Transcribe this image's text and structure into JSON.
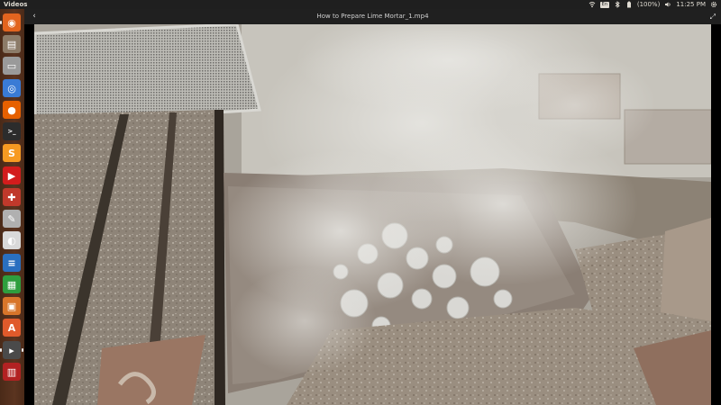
{
  "top_panel": {
    "app_name": "Videos",
    "battery": "(100%)",
    "time": "11:25 PM",
    "keyboard": "En",
    "icons": [
      "wifi-icon",
      "keyboard-layout-icon",
      "bluetooth-icon",
      "battery-icon",
      "volume-icon",
      "settings-gear-icon"
    ]
  },
  "launcher": {
    "items": [
      {
        "name": "ubuntu-dash-icon",
        "glyph": "◉",
        "color": "#e2641f"
      },
      {
        "name": "files-icon",
        "glyph": "▤",
        "color": "#8c7b68"
      },
      {
        "name": "disk-drive-icon",
        "glyph": "▭",
        "color": "#9a9a9a"
      },
      {
        "name": "chromium-icon",
        "glyph": "◎",
        "color": "#3a7bd5"
      },
      {
        "name": "firefox-icon",
        "glyph": "●",
        "color": "#e66000"
      },
      {
        "name": "terminal-icon",
        "glyph": ">_",
        "color": "#2c2c2c"
      },
      {
        "name": "sublime-text-icon",
        "glyph": "S",
        "color": "#f79a22"
      },
      {
        "name": "youtube-icon",
        "glyph": "▶",
        "color": "#d31c1c"
      },
      {
        "name": "system-tools-icon",
        "glyph": "✚",
        "color": "#c0392b"
      },
      {
        "name": "text-editor-icon",
        "glyph": "✎",
        "color": "#b0b0b0"
      },
      {
        "name": "update-manager-icon",
        "glyph": "◐",
        "color": "#d9d9d9"
      },
      {
        "name": "writer-document-icon",
        "glyph": "≡",
        "color": "#2a6fbf"
      },
      {
        "name": "calc-spreadsheet-icon",
        "glyph": "▦",
        "color": "#2e9e3e"
      },
      {
        "name": "impress-presentation-icon",
        "glyph": "▣",
        "color": "#d8752a"
      },
      {
        "name": "software-center-icon",
        "glyph": "A",
        "color": "#e05a2b"
      },
      {
        "name": "videos-player-icon",
        "glyph": "▸",
        "color": "#4a4a4a"
      },
      {
        "name": "screenshot-tool-icon",
        "glyph": "▥",
        "color": "#b22222"
      }
    ]
  },
  "video_window": {
    "title": "How to Prepare Lime Mortar_1.mp4",
    "back_glyph": "‹",
    "fullscreen_glyph": "⤢"
  }
}
